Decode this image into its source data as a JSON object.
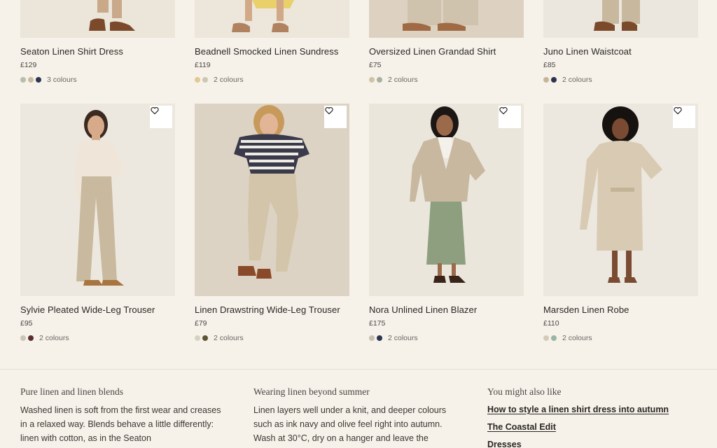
{
  "colors": {
    "background": "#f6f2ea",
    "photo_bg": "#ece6dc",
    "text": "#2a2724"
  },
  "products_top": [
    {
      "name": "Seaton Linen Shirt Dress",
      "price": "£129",
      "swatches": [
        "#b9bcae",
        "#c8bba3",
        "#2f3550"
      ],
      "colours_label": "3 colours"
    },
    {
      "name": "Beadnell Smocked Linen Sundress",
      "price": "£119",
      "swatches": [
        "#e2c98f",
        "#cfc6b3"
      ],
      "colours_label": "2 colours"
    },
    {
      "name": "Oversized Linen Grandad Shirt",
      "price": "£75",
      "swatches": [
        "#cfc3a7",
        "#a6b29b"
      ],
      "colours_label": "2 colours"
    },
    {
      "name": "Juno Linen Waistcoat",
      "price": "£85",
      "swatches": [
        "#c6b59a",
        "#2a3350"
      ],
      "colours_label": "2 colours"
    }
  ],
  "products_bottom": [
    {
      "name": "Sylvie Pleated Wide-Leg Trouser",
      "price": "£95",
      "swatches": [
        "#cbc5b8",
        "#5a2d33"
      ],
      "colours_label": "2 colours",
      "wishlist_icon": "heart-icon"
    },
    {
      "name": "Linen Drawstring Wide-Leg Trouser",
      "price": "£79",
      "swatches": [
        "#d6d2c0",
        "#5b5532"
      ],
      "colours_label": "2 colours",
      "wishlist_icon": "heart-icon"
    },
    {
      "name": "Nora Unlined Linen Blazer",
      "price": "£175",
      "swatches": [
        "#c6c0b3",
        "#2a3350"
      ],
      "colours_label": "2 colours",
      "wishlist_icon": "heart-icon"
    },
    {
      "name": "Marsden Linen Robe",
      "price": "£110",
      "swatches": [
        "#d2ccb9",
        "#9bb5a3"
      ],
      "colours_label": "2 colours",
      "wishlist_icon": "heart-icon"
    }
  ],
  "footer": {
    "col1": {
      "heading": "Pure linen and linen blends",
      "body": "Washed linen is soft from the first wear and creases in a relaxed way. Blends behave a little differently: linen with cotton, as in the Seaton"
    },
    "col2": {
      "heading": "Wearing linen beyond summer",
      "body": "Linen layers well under a knit, and deeper colours such as ink navy and olive feel right into autumn. Wash at 30°C, dry on a hanger and leave the"
    },
    "col3": {
      "heading": "You might also like",
      "links": [
        "How to style a linen shirt dress into autumn",
        "The Coastal Edit",
        "Dresses"
      ]
    }
  }
}
